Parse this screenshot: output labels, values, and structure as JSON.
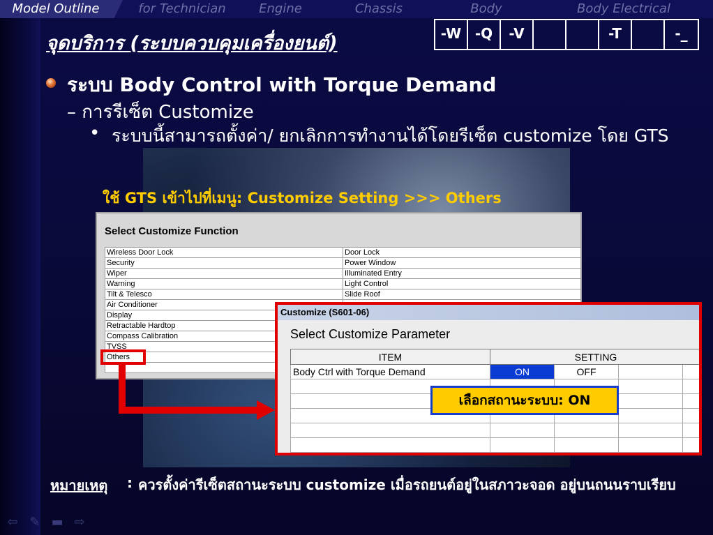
{
  "nav": {
    "tabs": [
      {
        "label": "Model Outline",
        "active": true
      },
      {
        "label": "for Technician",
        "active": false
      },
      {
        "label": "Engine",
        "active": false
      },
      {
        "label": "Chassis",
        "active": false
      },
      {
        "label": "Body",
        "active": false
      },
      {
        "label": "Body Electrical",
        "active": false
      }
    ]
  },
  "title": "จุดบริการ (ระบบควบคุมเครื่องยนต์)",
  "codes": [
    "-W",
    "-Q",
    "-V",
    "",
    "",
    "-T",
    "",
    "-_"
  ],
  "bullets": {
    "level1_prefix": "ระบบ",
    "level1": "Body Control with Torque Demand",
    "level2": "การรีเซ็ต Customize",
    "level3": "ระบบนี้สามารถตั้งค่า/ ยกเลิกการทำงานได้โดยรีเซ็ต customize โดย GTS"
  },
  "instruction": "ใช้ GTS เข้าไปที่เมนู: Customize Setting >>> Others",
  "window1": {
    "title": "Select Customize Function",
    "rows": [
      [
        "Wireless Door Lock",
        "Door Lock"
      ],
      [
        "Security",
        "Power Window"
      ],
      [
        "Wiper",
        "Illuminated Entry"
      ],
      [
        "Warning",
        "Light Control"
      ],
      [
        "Tilt & Telesco",
        "Slide Roof"
      ],
      [
        "Air Conditioner",
        ""
      ],
      [
        "Display",
        ""
      ],
      [
        "Retractable Hardtop",
        ""
      ],
      [
        "Compass Calibration",
        ""
      ],
      [
        "TVSS",
        ""
      ],
      [
        "Others",
        ""
      ],
      [
        "",
        ""
      ]
    ]
  },
  "window2": {
    "titlebar": "Customize (S601-06)",
    "heading": "Select Customize Parameter",
    "col_item": "ITEM",
    "col_setting": "SETTING",
    "item": "Body Ctrl with Torque Demand",
    "on": "ON",
    "off": "OFF"
  },
  "callout": "เลือกสถานะระบบ: ON",
  "note": {
    "label": "หมายเหตุ",
    "colon": ":",
    "text": "ควรตั้งค่ารีเซ็ตสถานะระบบ customize เมื่อรถยนต์อยู่ในสภาวะจอด อยู่บนถนนราบเรียบ"
  },
  "bottom_nav": [
    "back-icon",
    "pen-icon",
    "menu-icon",
    "forward-icon"
  ],
  "colors": {
    "accent": "#ffcc00",
    "highlight": "#e00000",
    "selected": "#0a3cd4"
  }
}
